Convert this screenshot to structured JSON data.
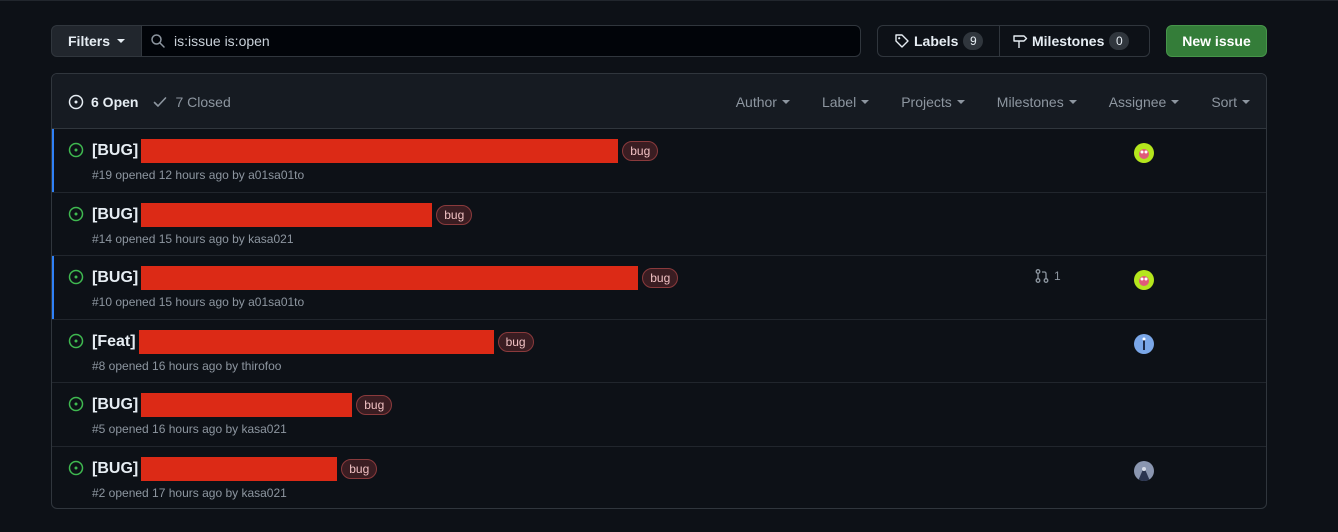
{
  "toolbar": {
    "filters_label": "Filters",
    "search_value": "is:issue is:open",
    "labels_label": "Labels",
    "labels_count": "9",
    "milestones_label": "Milestones",
    "milestones_count": "0",
    "new_issue_label": "New issue"
  },
  "header": {
    "open_label": "6 Open",
    "closed_label": "7 Closed",
    "filters": [
      "Author",
      "Label",
      "Projects",
      "Milestones",
      "Assignee",
      "Sort"
    ]
  },
  "colors": {
    "open_icon": "#3fb950",
    "new_issue_bg": "#347d39",
    "redaction": "#dc2a16",
    "unread_bar": "#2f81f7"
  },
  "issues": [
    {
      "title": "[BUG]",
      "label": "bug",
      "meta": "#19 opened 12 hours ago by a01sa01to",
      "prs": "",
      "assignee": "avatar-green"
    },
    {
      "title": "[BUG]",
      "label": "bug",
      "meta": "#14 opened 15 hours ago by kasa021",
      "prs": "",
      "assignee": ""
    },
    {
      "title": "[BUG]",
      "label": "bug",
      "meta": "#10 opened 15 hours ago by a01sa01to",
      "prs": "1",
      "assignee": "avatar-green"
    },
    {
      "title": "[Feat]",
      "label": "bug",
      "meta": "#8 opened 16 hours ago by thirofoo",
      "prs": "",
      "assignee": "avatar-blue"
    },
    {
      "title": "[BUG]",
      "label": "bug",
      "meta": "#5 opened 16 hours ago by kasa021",
      "prs": "",
      "assignee": ""
    },
    {
      "title": "[BUG]",
      "label": "bug",
      "meta": "#2 opened 17 hours ago by kasa021",
      "prs": "",
      "assignee": "avatar-gray"
    }
  ]
}
